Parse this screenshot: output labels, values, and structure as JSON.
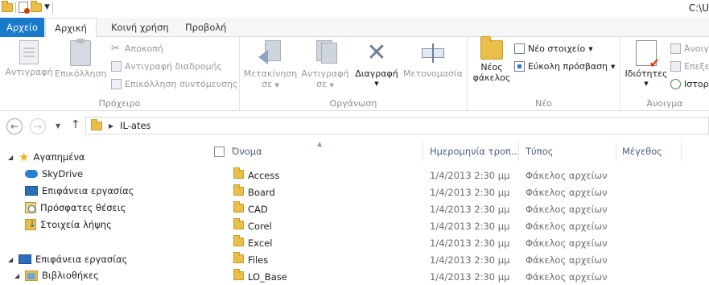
{
  "window": {
    "title": "C:\\U"
  },
  "quick_access": {
    "icons": [
      "folder-icon",
      "properties-icon",
      "new-folder-icon",
      "customize-dropdown-icon"
    ]
  },
  "tabs": [
    {
      "label": "Αρχείο"
    },
    {
      "label": "Αρχική"
    },
    {
      "label": "Κοινή χρήση"
    },
    {
      "label": "Προβολή"
    }
  ],
  "ribbon": {
    "clipboard": {
      "label": "Πρόχειρο",
      "copy": "Αντιγραφή",
      "paste": "Επικόλληση",
      "cut": "Αποκοπή",
      "copy_path": "Αντιγραφή διαδρομής",
      "paste_shortcut": "Επικόλληση συντόμευσης"
    },
    "organize": {
      "label": "Οργάνωση",
      "move_to_1": "Μετακίνηση",
      "move_to_2": "σε",
      "copy_to_1": "Αντιγραφή",
      "copy_to_2": "σε",
      "delete": "Διαγραφή",
      "rename": "Μετονομασία"
    },
    "new": {
      "label": "Νέο",
      "new_folder_1": "Νέος",
      "new_folder_2": "φάκελος",
      "new_item": "Νέο στοιχείο",
      "easy_access": "Εύκολη πρόσβαση"
    },
    "open": {
      "label": "Άνοιγμα",
      "properties": "Ιδιότητες",
      "open": "Άνοιγ",
      "edit": "Επεξε",
      "history": "Ιστορ"
    }
  },
  "address": {
    "crumb": "IL-ates"
  },
  "nav": {
    "favorites": "Αγαπημένα",
    "skydrive": "SkyDrive",
    "desktop_fav": "Επιφάνεια εργασίας",
    "recent": "Πρόσφατες θέσεις",
    "downloads": "Στοιχεία λήψης",
    "desktop": "Επιφάνεια εργασίας",
    "libraries": "Βιβλιοθήκες"
  },
  "columns": {
    "name": "Όνομα",
    "date": "Ημερομηνία τροπ...",
    "type": "Τύπος",
    "size": "Μέγεθος"
  },
  "files": [
    {
      "name": "Access",
      "date": "1/4/2013 2:30 μμ",
      "type": "Φάκελος αρχείων"
    },
    {
      "name": "Board",
      "date": "1/4/2013 2:30 μμ",
      "type": "Φάκελος αρχείων"
    },
    {
      "name": "CAD",
      "date": "1/4/2013 2:30 μμ",
      "type": "Φάκελος αρχείων"
    },
    {
      "name": "Corel",
      "date": "1/4/2013 2:30 μμ",
      "type": "Φάκελος αρχείων"
    },
    {
      "name": "Excel",
      "date": "1/4/2013 2:30 μμ",
      "type": "Φάκελος αρχείων"
    },
    {
      "name": "Files",
      "date": "1/4/2013 2:30 μμ",
      "type": "Φάκελος αρχείων"
    },
    {
      "name": "LO_Base",
      "date": "1/4/2013 2:30 μμ",
      "type": "Φάκελος αρχείων"
    }
  ]
}
